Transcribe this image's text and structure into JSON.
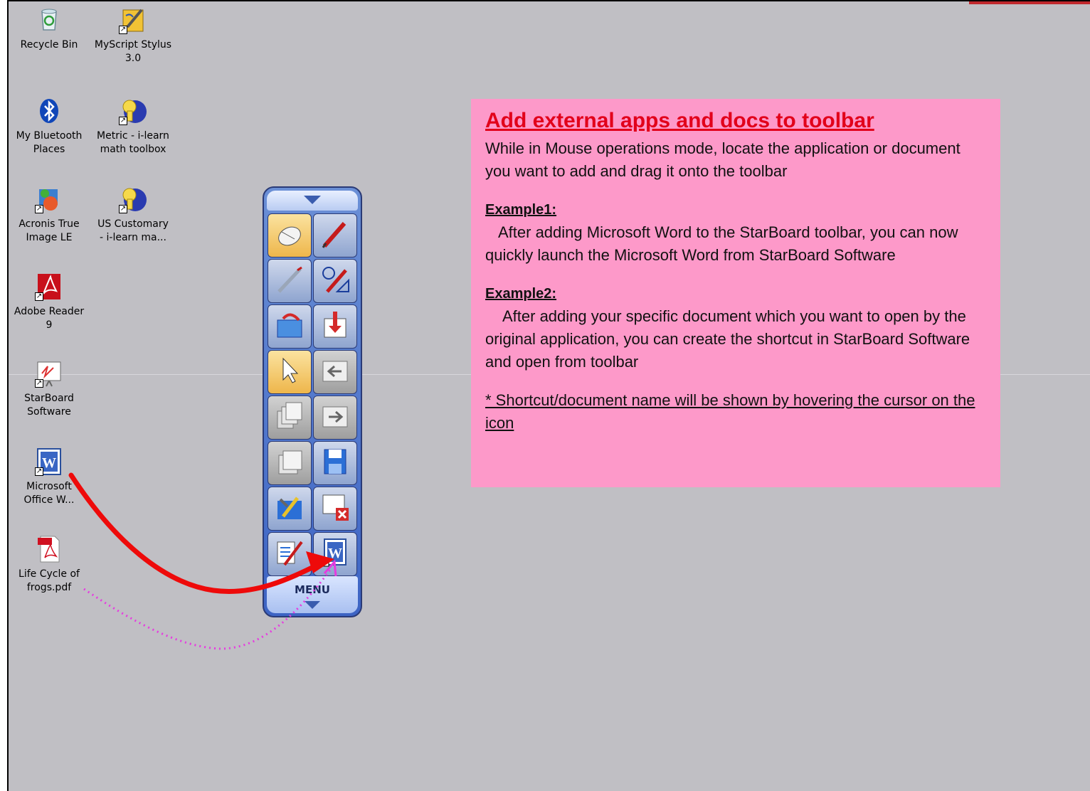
{
  "desktop": {
    "icons": [
      {
        "label": "Recycle Bin",
        "icon": "recycle-bin-icon"
      },
      {
        "label": "MyScript Stylus\n3.0",
        "icon": "myscript-stylus-icon"
      },
      {
        "label": "My Bluetooth\nPlaces",
        "icon": "bluetooth-icon"
      },
      {
        "label": "Metric - i-learn\nmath toolbox",
        "icon": "i-learn-icon"
      },
      {
        "label": "Acronis True\nImage LE",
        "icon": "acronis-icon"
      },
      {
        "label": "US Customary\n- i-learn ma...",
        "icon": "i-learn-icon"
      },
      {
        "label": "Adobe Reader\n9",
        "icon": "adobe-reader-icon"
      },
      {
        "label": "StarBoard\nSoftware",
        "icon": "starboard-icon"
      },
      {
        "label": "Microsoft\nOffice W...",
        "icon": "word-icon"
      },
      {
        "label": "Life Cycle of\nfrogs.pdf",
        "icon": "pdf-file-icon"
      }
    ]
  },
  "toolbar": {
    "menu_label": "MENU",
    "buttons": [
      {
        "name": "mouse-mode",
        "icon": "mouse-icon",
        "selected": true
      },
      {
        "name": "pen",
        "icon": "pen-icon"
      },
      {
        "name": "highlighter",
        "icon": "stylus-icon"
      },
      {
        "name": "shape-pen",
        "icon": "shape-pen-icon"
      },
      {
        "name": "open-file",
        "icon": "open-folder-icon"
      },
      {
        "name": "import",
        "icon": "import-arrow-icon"
      },
      {
        "name": "select",
        "icon": "cursor-arrow-icon",
        "selected": true
      },
      {
        "name": "back",
        "icon": "back-arrow-icon"
      },
      {
        "name": "pages",
        "icon": "pages-icon"
      },
      {
        "name": "forward",
        "icon": "forward-arrow-icon"
      },
      {
        "name": "page-stack",
        "icon": "page-stack-icon"
      },
      {
        "name": "save",
        "icon": "save-disk-icon"
      },
      {
        "name": "tools",
        "icon": "tools-icon"
      },
      {
        "name": "close-board",
        "icon": "close-board-icon"
      },
      {
        "name": "settings",
        "icon": "edit-settings-icon"
      },
      {
        "name": "word-shortcut",
        "icon": "word-icon"
      }
    ]
  },
  "note": {
    "title": "Add external apps and docs to toolbar",
    "intro": "While in Mouse operations mode, locate the application or document you want to add and drag it onto the toolbar",
    "example1_heading": "Example1:",
    "example1_text": "After adding Microsoft Word to the StarBoard toolbar, you can now quickly launch the Microsoft Word from StarBoard Software",
    "example2_heading": "Example2:",
    "example2_text": "After adding your specific document which you want to open by the original application, you can create the shortcut in StarBoard Software and open from toolbar",
    "footnote": "* Shortcut/document name will be shown by hovering the cursor on the icon"
  },
  "colors": {
    "desktop_bg": "#c0bfc4",
    "note_bg": "#fd99c9",
    "title_red": "#e2001a",
    "arrow_red": "#ee0a0a",
    "dotted_magenta": "#e63be0"
  }
}
